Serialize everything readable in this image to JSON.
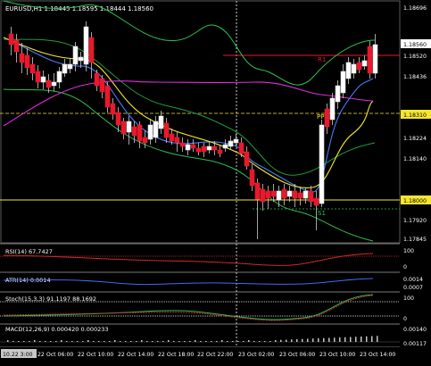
{
  "colors": {
    "background": "#000000",
    "bull_candle": "#ffffff",
    "bear_candle": "#e8192c",
    "outer_band": "#2fbf52",
    "mid_band": "#1e9c3e",
    "ma_fast": "#4a7cf7",
    "ma_slow": "#f5e631",
    "ma_long": "#e22be0",
    "level_line": "#e8192c",
    "sr_line": "#f5e631",
    "separator": "#808080"
  },
  "main": {
    "title": "EURUSD,H1  1.18445 1.18595 1.18444 1.18560",
    "labels": {
      "r1": "R1",
      "s1": "S1",
      "pivot": "PP"
    },
    "price_axis": [
      "1.18696",
      "1.18560",
      "1.18520",
      "1.18436",
      "1.18310",
      "1.18224",
      "1.18140",
      "1.18000",
      "1.17920",
      "1.17845"
    ],
    "highlighted": {
      "current": "1.18560",
      "pivot": "1.18310",
      "support": "1.18000"
    }
  },
  "indicators": {
    "rsi": {
      "label": "RSI(14) 67.7427",
      "axis": [
        "100",
        "0"
      ]
    },
    "atr": {
      "label": "ATR(14) 0.0014",
      "axis": [
        "0.0014",
        "0.0007"
      ]
    },
    "stoch": {
      "label": "Stoch(15,3,3) 91.1197 88.1692",
      "axis": [
        "100",
        "0"
      ]
    },
    "macd": {
      "label": "MACD(12,26,9) 0.000420 0.000233",
      "axis": [
        "0.00140",
        "0.00117"
      ]
    }
  },
  "time_axis": [
    "10.22 3:00",
    "22 Oct 06:00",
    "22 Oct 10:00",
    "22 Oct 14:00",
    "22 Oct 18:00",
    "22 Oct 22:00",
    "23 Oct 02:00",
    "23 Oct 06:00",
    "23 Oct 10:00",
    "23 Oct 14:00"
  ]
}
